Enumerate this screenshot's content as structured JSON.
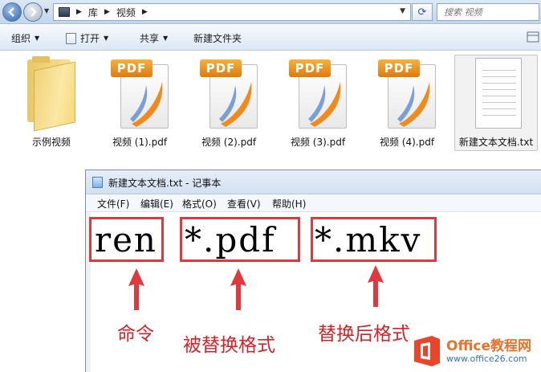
{
  "explorer": {
    "breadcrumb": [
      "库",
      "视频"
    ],
    "search_placeholder": "搜索 视频",
    "toolbar": {
      "organize": "组织",
      "open": "打开",
      "share": "共享",
      "new_folder": "新建文件夹"
    },
    "files": [
      {
        "name": "示例视频",
        "type": "folder"
      },
      {
        "name": "视频 (1).pdf",
        "type": "pdf"
      },
      {
        "name": "视频 (2).pdf",
        "type": "pdf"
      },
      {
        "name": "视频 (3).pdf",
        "type": "pdf"
      },
      {
        "name": "视频 (4).pdf",
        "type": "pdf"
      },
      {
        "name": "新建文本文档.txt",
        "type": "txt"
      }
    ],
    "pdf_badge": "PDF"
  },
  "notepad": {
    "title": "新建文本文档.txt - 记事本",
    "menu": [
      "文件(F)",
      "编辑(E)",
      "格式(O)",
      "查看(V)",
      "帮助(H)"
    ],
    "content": {
      "command": "ren",
      "source_pattern": "*.pdf",
      "target_pattern": "*.mkv"
    }
  },
  "annotations": {
    "command": "命令",
    "source": "被替换格式",
    "target": "替换后格式"
  },
  "watermark": {
    "brand": "Office教程网",
    "url": "www.office26.com"
  },
  "colors": {
    "annotation_red": "#e0383d",
    "pdf_orange": "#f08a1c"
  }
}
